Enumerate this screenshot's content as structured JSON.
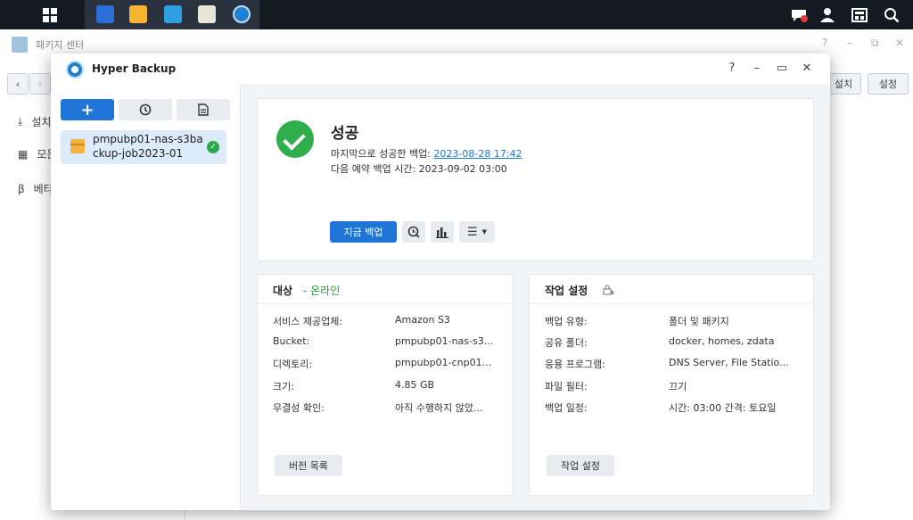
{
  "taskbar": {
    "icons": [
      "apps-grid-icon",
      "package-center-icon",
      "file-station-icon",
      "download-station-icon",
      "storage-icon",
      "hyper-backup-icon"
    ],
    "right_icons": [
      "notifications-icon",
      "user-icon",
      "widgets-icon",
      "search-icon"
    ]
  },
  "package_center": {
    "title": "패키지 센터",
    "nav": [
      "설치",
      "모든",
      "베타"
    ],
    "buttons": {
      "install": "설치",
      "settings": "설정"
    }
  },
  "hyper_backup": {
    "title": "Hyper Backup",
    "controls": {
      "help": "?",
      "minimize": "–",
      "maximize": "▭",
      "close": "✕"
    },
    "sidebar": {
      "add_label": "+",
      "task": {
        "name": "pmpubp01-nas-s3backup-job2023-01"
      }
    },
    "status": {
      "title": "성공",
      "last_success_label": "마지막으로 성공한 백업: ",
      "last_success_value": "2023-08-28 17:42",
      "next_backup": "다음 예약 백업 시간: 2023-09-02 03:00",
      "backup_now": "지금 백업"
    },
    "target": {
      "title": "대상",
      "status": "- 온라인",
      "rows": [
        {
          "label": "서비스 제공업체:",
          "value": "Amazon S3"
        },
        {
          "label": "Bucket:",
          "value": "pmpubp01-nas-s3..."
        },
        {
          "label": "디렉토리:",
          "value": "pmpubp01-cnp01..."
        },
        {
          "label": "크기:",
          "value": "4.85 GB"
        },
        {
          "label": "무결성 확인:",
          "value": "아직 수행하지 않았..."
        }
      ],
      "button": "버전 목록"
    },
    "task_settings": {
      "title": "작업 설정",
      "rows": [
        {
          "label": "백업 유형:",
          "value": "폴더 및 패키지"
        },
        {
          "label": "공유 폴더:",
          "value": "docker, homes, zdata"
        },
        {
          "label": "응용 프로그램:",
          "value": "DNS Server, File Statio..."
        },
        {
          "label": "파일 필터:",
          "value": "끄기"
        },
        {
          "label": "백업 일정:",
          "value": "시간: 03:00 간격: 토요일"
        }
      ],
      "button": "작업 설정"
    }
  }
}
